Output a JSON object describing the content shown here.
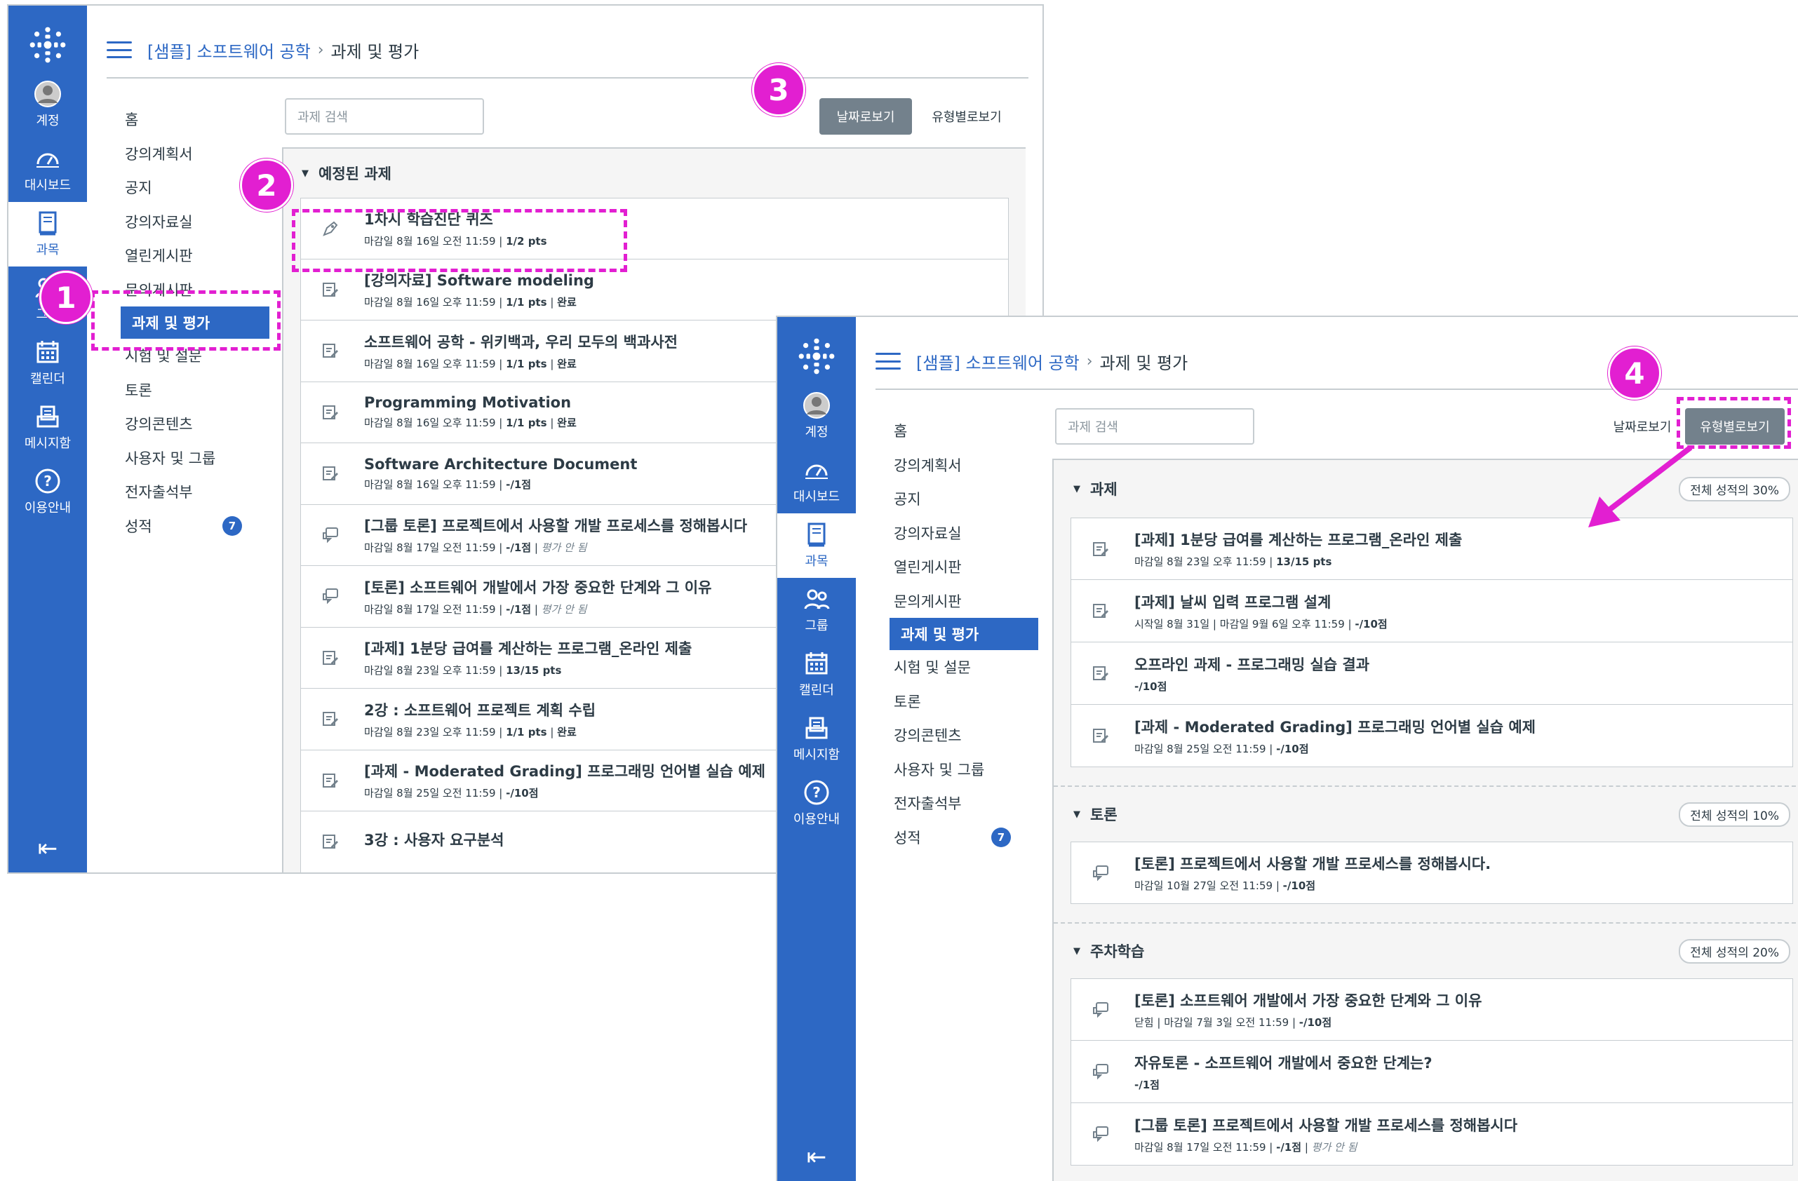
{
  "gnav": {
    "account": "계정",
    "dashboard": "대시보드",
    "courses": "과목",
    "groups": "그룹",
    "calendar": "캘린더",
    "inbox": "메시지함",
    "help": "이용안내"
  },
  "breadcrumb": {
    "course": "[샘플] 소프트웨어 공학",
    "sep": "›",
    "page": "과제 및 평가"
  },
  "course_nav": [
    {
      "label": "홈"
    },
    {
      "label": "강의계획서"
    },
    {
      "label": "공지"
    },
    {
      "label": "강의자료실"
    },
    {
      "label": "열린게시판"
    },
    {
      "label": "문의게시판"
    },
    {
      "label": "과제 및 평가",
      "active": true
    },
    {
      "label": "시험 및 설문"
    },
    {
      "label": "토론"
    },
    {
      "label": "강의콘텐츠"
    },
    {
      "label": "사용자 및 그룹"
    },
    {
      "label": "전자출석부"
    },
    {
      "label": "성적",
      "badge": "7"
    }
  ],
  "search_placeholder": "과제 검색",
  "view_buttons": {
    "by_date": "날짜로보기",
    "by_type": "유형별로보기"
  },
  "callouts": [
    "1",
    "2",
    "3",
    "4"
  ],
  "window1": {
    "group_title": "예정된 과제",
    "items": [
      {
        "icon": "quiz-icon",
        "title": "1차시 학습진단 퀴즈",
        "due": "마감일 8월 16일 오전 11:59",
        "pts": "1/2 pts",
        "extra": ""
      },
      {
        "icon": "assignment-icon",
        "title": "[강의자료] Software modeling",
        "due": "마감일 8월 16일 오후 11:59",
        "pts": "1/1 pts",
        "extra": "완료"
      },
      {
        "icon": "assignment-icon",
        "title": "소프트웨어 공학 - 위키백과, 우리 모두의 백과사전",
        "due": "마감일 8월 16일 오후 11:59",
        "pts": "1/1 pts",
        "extra": "완료"
      },
      {
        "icon": "assignment-icon",
        "title": "Programming Motivation",
        "due": "마감일 8월 16일 오후 11:59",
        "pts": "1/1 pts",
        "extra": "완료"
      },
      {
        "icon": "assignment-icon",
        "title": "Software Architecture Document",
        "due": "마감일 8월 16일 오후 11:59",
        "pts": "-/1점",
        "extra": ""
      },
      {
        "icon": "discussion-icon",
        "title": "[그룹 토론] 프로젝트에서 사용할 개발 프로세스를 정해봅시다",
        "due": "마감일 8월 17일 오전 11:59",
        "pts": "-/1점",
        "extra": "평가 안 됨"
      },
      {
        "icon": "discussion-icon",
        "title": "[토론] 소프트웨어 개발에서 가장 중요한 단계와 그 이유",
        "due": "마감일 8월 17일 오전 11:59",
        "pts": "-/1점",
        "extra": "평가 안 됨"
      },
      {
        "icon": "assignment-icon",
        "title": "[과제] 1분당 급여를 계산하는 프로그램_온라인 제출",
        "due": "마감일 8월 23일 오후 11:59",
        "pts": "13/15 pts",
        "extra": ""
      },
      {
        "icon": "assignment-icon",
        "title": "2강 : 소프트웨어 프로젝트 계획 수립",
        "due": "마감일 8월 23일 오후 11:59",
        "pts": "1/1 pts",
        "extra": "완료"
      },
      {
        "icon": "assignment-icon",
        "title": "[과제 - Moderated Grading] 프로그래밍 언어별 실습 예제",
        "due": "마감일 8월 25일 오전 11:59",
        "pts": "-/10점",
        "extra": ""
      },
      {
        "icon": "assignment-icon",
        "title": "3강 : 사용자 요구분석",
        "due": "",
        "pts": "",
        "extra": ""
      }
    ]
  },
  "window2": {
    "groups": [
      {
        "title": "과제",
        "weight": "전체 성적의 30%",
        "items": [
          {
            "icon": "assignment-icon",
            "title": "[과제] 1분당 급여를 계산하는 프로그램_온라인 제출",
            "meta": "마감일 8월 23일 오후 11:59",
            "pts": "13/15 pts"
          },
          {
            "icon": "assignment-icon",
            "title": "[과제] 날씨 입력 프로그램 설계",
            "meta": "시작일 8월 31일  |  마감일 9월 6일 오후 11:59",
            "pts": "-/10점"
          },
          {
            "icon": "assignment-icon",
            "title": "오프라인 과제 - 프로그래밍 실습 결과",
            "meta": "",
            "pts": "-/10점"
          },
          {
            "icon": "assignment-icon",
            "title": "[과제 - Moderated Grading] 프로그래밍 언어별 실습 예제",
            "meta": "마감일 8월 25일 오전 11:59",
            "pts": "-/10점"
          }
        ]
      },
      {
        "title": "토론",
        "weight": "전체 성적의 10%",
        "items": [
          {
            "icon": "discussion-icon",
            "title": "[토론] 프로젝트에서 사용할 개발 프로세스를 정해봅시다.",
            "meta": "마감일 10월 27일 오전 11:59",
            "pts": "-/10점"
          }
        ]
      },
      {
        "title": "주차학습",
        "weight": "전체 성적의 20%",
        "items": [
          {
            "icon": "discussion-icon",
            "title": "[토론] 소프트웨어 개발에서 가장 중요한 단계와 그 이유",
            "meta": "닫힘  |  마감일 7월 3일 오전 11:59",
            "pts": "-/10점"
          },
          {
            "icon": "discussion-icon",
            "title": "자유토론 - 소프트웨어 개발에서 중요한 단계는?",
            "meta": "",
            "pts": "-/1점"
          },
          {
            "icon": "discussion-icon",
            "title": "[그룹 토론] 프로젝트에서 사용할 개발 프로세스를 정해봅시다",
            "meta": "마감일 8월 17일 오전 11:59",
            "pts": "-/1점",
            "extra": "평가 안 됨"
          }
        ]
      }
    ]
  },
  "colors": {
    "brand": "#2d68c4",
    "highlight": "#e21fd1",
    "muted_button": "#73818c"
  }
}
